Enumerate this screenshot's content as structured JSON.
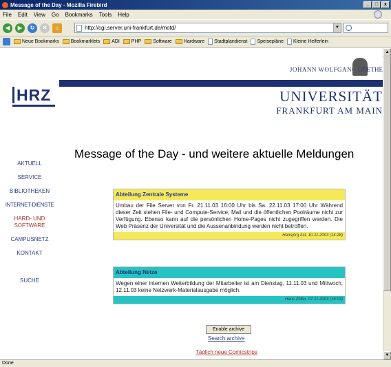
{
  "window": {
    "title": "Message of the Day - Mozilla Firebird",
    "controls": [
      "_",
      "□",
      "x"
    ]
  },
  "menu": [
    "File",
    "Edit",
    "View",
    "Go",
    "Bookmarks",
    "Tools",
    "Help"
  ],
  "nav": {
    "url": "http://cgi.server.uni-frankfurt.de/motd/"
  },
  "bookmarks": [
    {
      "label": "Neue Bookmarks",
      "type": "folder"
    },
    {
      "label": "Bookmarklets",
      "type": "folder"
    },
    {
      "label": "ADI",
      "type": "folder"
    },
    {
      "label": "PHP",
      "type": "folder"
    },
    {
      "label": "Software",
      "type": "folder"
    },
    {
      "label": "Hardware",
      "type": "folder"
    },
    {
      "label": "Stadtplandienst",
      "type": "file"
    },
    {
      "label": "Speisepläne",
      "type": "file"
    },
    {
      "label": "Kleine Helferlein",
      "type": "file"
    }
  ],
  "status": "Done",
  "header": {
    "goethe_left": "JOHANN WOLFGANG",
    "goethe_right": "GOETHE",
    "logo": "HRZ",
    "university": "UNIVERSITÄT",
    "city": "FRANKFURT AM MAIN"
  },
  "sidebar": {
    "items": [
      {
        "label": "Aktuell"
      },
      {
        "label": "Service"
      },
      {
        "label": "Bibliotheken"
      },
      {
        "label": "Internet-Dienste"
      },
      {
        "label": "Hard- und"
      },
      {
        "label": "Software"
      },
      {
        "label": "Campusnetz"
      },
      {
        "label": "Kontakt"
      },
      {
        "label": "Suche"
      }
    ]
  },
  "main": {
    "title": "Message of the Day - und weitere aktuelle Meldungen",
    "messages": [
      {
        "heading": "Abteilung Zentrale Systeme",
        "body": "Umbau der File Server von Fr. 21.11.03 16:00 Uhr bis Sa. 22.11.03 17:00 Uhr Während dieser Zeit stehen File- und Compute-Service, Mail und die öffentlichen Poolräume nicht zur Verfügung. Ebenso kann auf die persönlichen Home-Pages nicht zugegriffen werden. Die Web Präsenz der Universität und die Aussenanbindung werden nicht betroffen.",
        "footer": "Hansjörg Ast, 10.11.2003 (14:28)"
      },
      {
        "heading": "Abteilung Netze",
        "body": "Wegen einer internen Weiterbildung der Mitarbeiter ist am Dienstag, 11.11.03 und Mittwoch, 12.11.03 keine Netzwerk-Materialausgabe möglich.",
        "footer": "Hans Zöller, 07.11.2003 (16:03)"
      }
    ],
    "archive_button": "Enable archive",
    "search_archive": "Search archive",
    "comic_link": "Täglich neue Comicstrips"
  },
  "colors": {
    "brand_blue": "#1f3170",
    "box1_accent": "#f5e95a",
    "box2_accent": "#26c3c3",
    "link_red": "#b03030"
  }
}
